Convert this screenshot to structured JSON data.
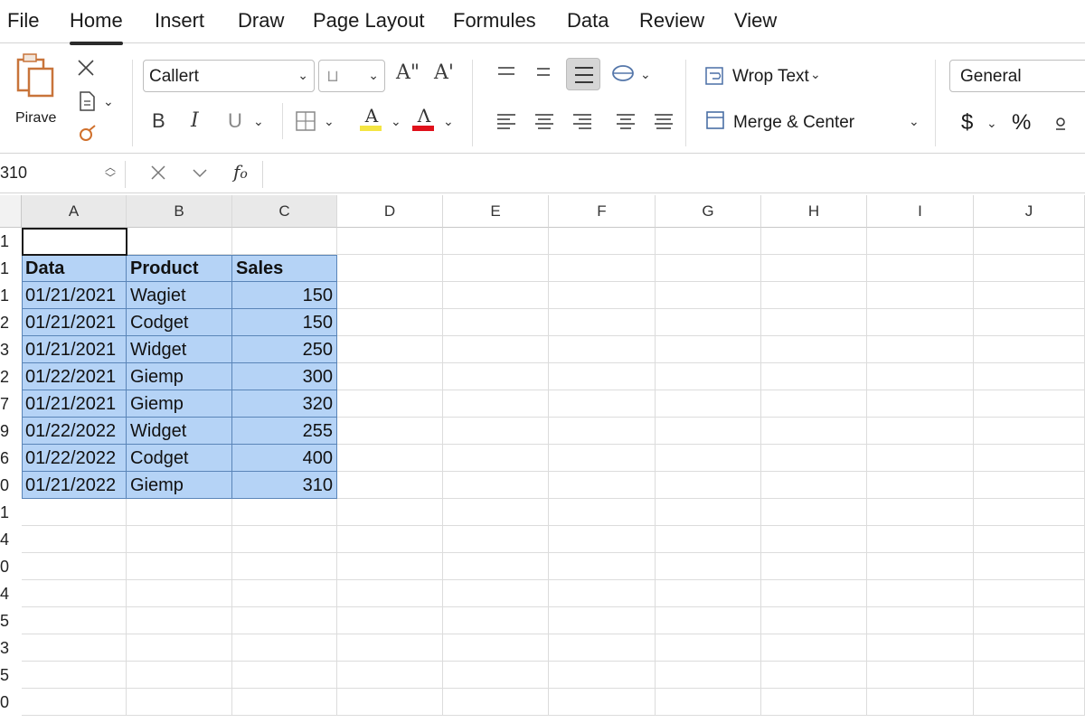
{
  "menu": {
    "items": [
      {
        "label": "File",
        "name": "menu-file"
      },
      {
        "label": "Home",
        "name": "menu-home",
        "active": true
      },
      {
        "label": "Insert",
        "name": "menu-insert"
      },
      {
        "label": "Draw",
        "name": "menu-draw"
      },
      {
        "label": "Page Layout",
        "name": "menu-page-layout"
      },
      {
        "label": "Formules",
        "name": "menu-formules"
      },
      {
        "label": "Data",
        "name": "menu-data"
      },
      {
        "label": "Review",
        "name": "menu-review"
      },
      {
        "label": "View",
        "name": "menu-view"
      }
    ]
  },
  "ribbon": {
    "paste_label": "Pirave",
    "font_name": "Callert",
    "font_size": "",
    "wrap_text": "Wrop Text",
    "merge_center": "Merge & Center",
    "number_format": "General",
    "currency_symbol": "$",
    "percent_symbol": "%",
    "bold_glyph": "B",
    "italic_glyph": "I",
    "underline_glyph": "U",
    "grow_font_glyph": "A\"",
    "shrink_font_glyph": "A'",
    "highlight_color": "#f4e542",
    "font_color": "#e0111b",
    "selected_align_bg": "#d6d6d6"
  },
  "formula_bar": {
    "name_box": "310",
    "formula": ""
  },
  "grid": {
    "columns": [
      "A",
      "B",
      "C",
      "D",
      "E",
      "F",
      "G",
      "H",
      "I",
      "J"
    ],
    "row_numbers": [
      "1",
      "1",
      "1",
      "2",
      "3",
      "2",
      "7",
      "9",
      "6",
      "0",
      "1",
      "4",
      "0",
      "4",
      "5",
      "3",
      "5",
      "0"
    ],
    "highlight_color": "#b5d3f6",
    "table": {
      "headers": [
        "Data",
        "Product",
        "Sales"
      ],
      "rows": [
        [
          "01/21/2021",
          "Wagiet",
          "150"
        ],
        [
          "01/21/2021",
          "Codget",
          "150"
        ],
        [
          "01/21/2021",
          "Widget",
          "250"
        ],
        [
          "01/22/2021",
          "Giemp",
          "300"
        ],
        [
          "01/21/2021",
          "Giemp",
          "320"
        ],
        [
          "01/22/2022",
          "Widget",
          "255"
        ],
        [
          "01/22/2022",
          "Codget",
          "400"
        ],
        [
          "01/21/2022",
          "Giemp",
          "310"
        ]
      ]
    }
  }
}
